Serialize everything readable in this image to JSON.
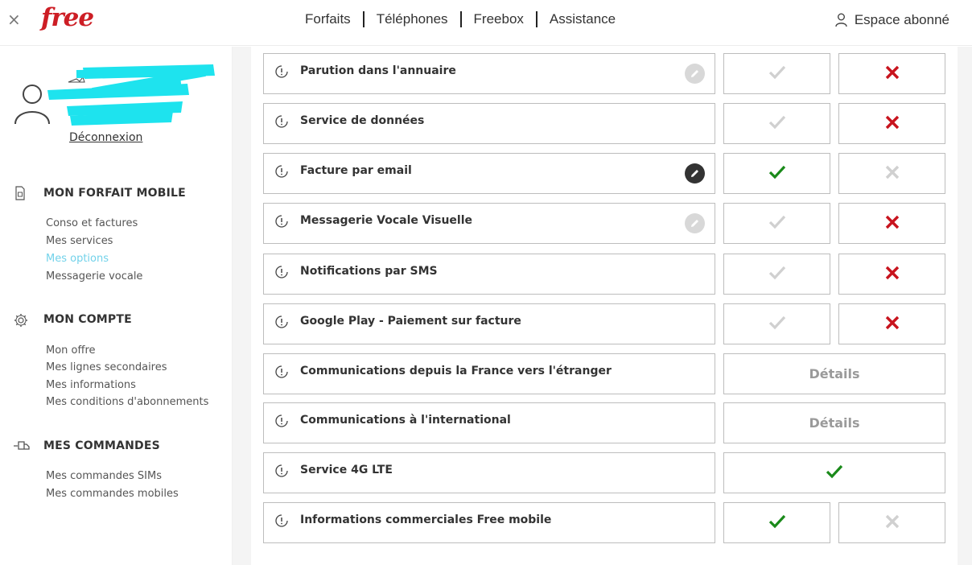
{
  "header": {
    "close_symbol": "×",
    "logo": "free",
    "nav": [
      "Forfaits",
      "Téléphones",
      "Freebox",
      "Assistance"
    ],
    "account_label": "Espace abonné"
  },
  "colors": {
    "brand_red": "#cd1e25",
    "active_link": "#72d2ea",
    "check_green": "#1a8a1a",
    "cross_red": "#c8141e",
    "disabled_grey": "#d0d0d0",
    "redaction_cyan": "#1ee3ee"
  },
  "sidebar": {
    "logout_label": "Déconnexion",
    "sections": [
      {
        "title": "MON FORFAIT MOBILE",
        "icon": "sim-card-icon",
        "links": [
          {
            "label": "Conso et factures",
            "active": false
          },
          {
            "label": "Mes services",
            "active": false
          },
          {
            "label": "Mes options",
            "active": true
          },
          {
            "label": "Messagerie vocale",
            "active": false
          }
        ]
      },
      {
        "title": "MON COMPTE",
        "icon": "gear-icon",
        "links": [
          {
            "label": "Mon offre",
            "active": false
          },
          {
            "label": "Mes lignes secondaires",
            "active": false
          },
          {
            "label": "Mes informations",
            "active": false
          },
          {
            "label": "Mes conditions d'abonnements",
            "active": false
          }
        ]
      },
      {
        "title": "MES COMMANDES",
        "icon": "delivery-truck-icon",
        "links": [
          {
            "label": "Mes commandes SIMs",
            "active": false
          },
          {
            "label": "Mes commandes mobiles",
            "active": false
          }
        ]
      }
    ]
  },
  "options": [
    {
      "label": "Parution dans l'annuaire",
      "edit": "disabled",
      "state": "no"
    },
    {
      "label": "Service de données",
      "edit": "none",
      "state": "no"
    },
    {
      "label": "Facture par email",
      "edit": "enabled",
      "state": "yes"
    },
    {
      "label": "Messagerie Vocale Visuelle",
      "edit": "disabled",
      "state": "no"
    },
    {
      "label": "Notifications par SMS",
      "edit": "none",
      "state": "no"
    },
    {
      "label": "Google Play - Paiement sur facture",
      "edit": "none",
      "state": "no"
    },
    {
      "label": "Communications depuis la France vers l'étranger",
      "edit": "none",
      "state": "details",
      "details_label": "Détails"
    },
    {
      "label": "Communications à l'international",
      "edit": "none",
      "state": "details",
      "details_label": "Détails"
    },
    {
      "label": "Service 4G LTE",
      "edit": "none",
      "state": "always"
    },
    {
      "label": "Informations commerciales Free mobile",
      "edit": "none",
      "state": "yes"
    }
  ]
}
